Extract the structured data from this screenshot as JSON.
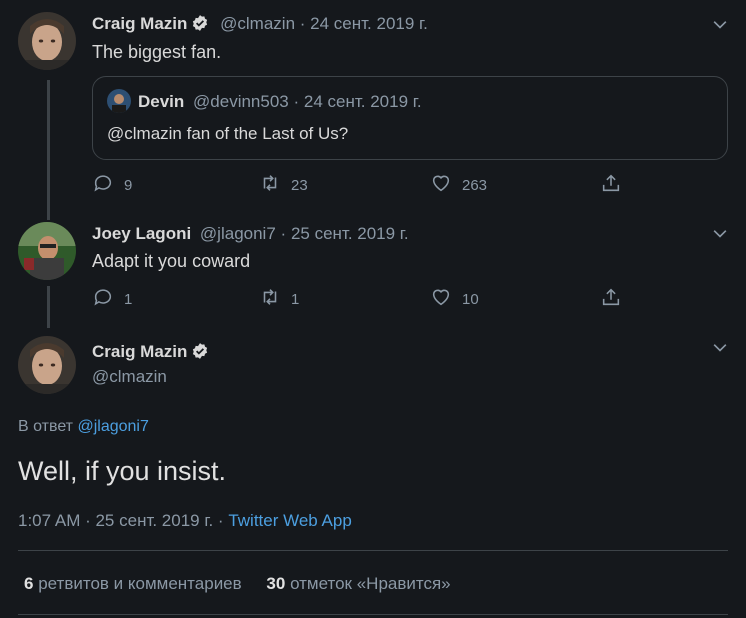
{
  "tweet1": {
    "name": "Craig Mazin",
    "handle": "@clmazin",
    "sep": "·",
    "date": "24 сент. 2019 г.",
    "text": "The biggest fan.",
    "quote": {
      "name": "Devin",
      "handle": "@devinn503",
      "sep": "·",
      "date": "24 сент. 2019 г.",
      "text": "@clmazin fan of the Last of Us?"
    },
    "replies": "9",
    "retweets": "23",
    "likes": "263"
  },
  "tweet2": {
    "name": "Joey Lagoni",
    "handle": "@jlagoni7",
    "sep": "·",
    "date": "25 сент. 2019 г.",
    "text": "Adapt it you coward",
    "replies": "1",
    "retweets": "1",
    "likes": "10"
  },
  "main": {
    "name": "Craig Mazin",
    "handle": "@clmazin",
    "reply_prefix": "В ответ",
    "reply_to": "@jlagoni7",
    "text": "Well, if you insist.",
    "time": "1:07 AM · 25 сент. 2019 г. ·",
    "source": "Twitter Web App",
    "retweets_count": "6",
    "retweets_label": "ретвитов и комментариев",
    "likes_count": "30",
    "likes_label": "отметок «Нравится»"
  },
  "icons": {
    "reply": "speech-bubble-icon",
    "retweet": "retweet-icon",
    "like": "heart-icon",
    "share": "share-icon"
  }
}
